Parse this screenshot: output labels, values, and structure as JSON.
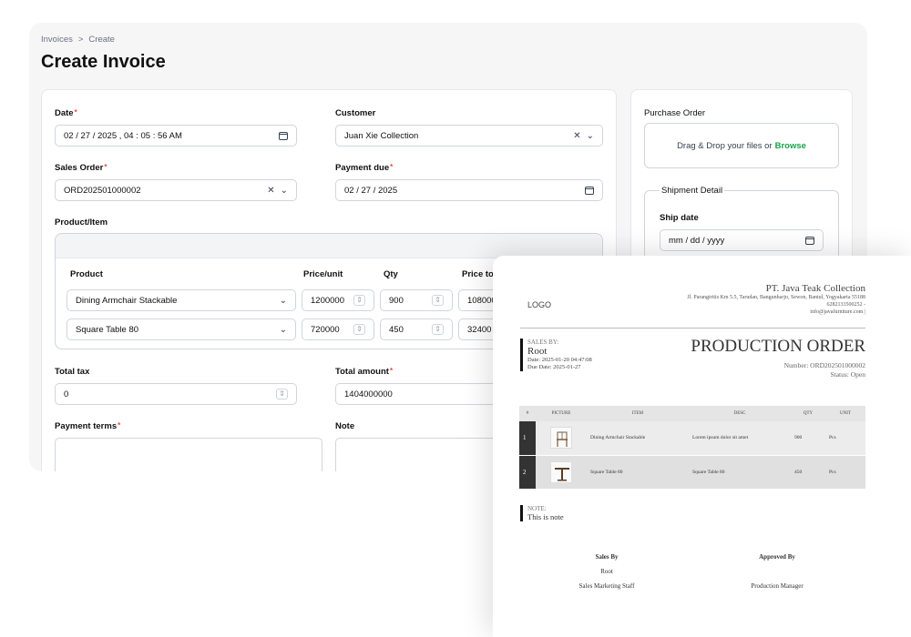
{
  "breadcrumb": {
    "items": [
      "Invoices",
      "Create"
    ],
    "separator": ">"
  },
  "page_title": "Create Invoice",
  "form": {
    "date": {
      "label": "Date",
      "value": "02 / 27 / 2025 ,  04 : 05 : 56   AM"
    },
    "customer": {
      "label": "Customer",
      "value": "Juan Xie Collection"
    },
    "sales_order": {
      "label": "Sales Order",
      "value": "ORD202501000002"
    },
    "payment_due": {
      "label": "Payment due",
      "value": "02 / 27 / 2025"
    },
    "product_item_label": "Product/Item",
    "table": {
      "headers": [
        "Product",
        "Price/unit",
        "Qty",
        "Price tot"
      ],
      "rows": [
        {
          "product": "Dining Armchair Stackable",
          "price": "1200000",
          "qty": "900",
          "total": "108000"
        },
        {
          "product": "Square Table 80",
          "price": "720000",
          "qty": "450",
          "total": "32400"
        }
      ]
    },
    "total_tax": {
      "label": "Total tax",
      "value": "0"
    },
    "total_amount": {
      "label": "Total amount",
      "value": "1404000000"
    },
    "payment_terms": {
      "label": "Payment terms"
    },
    "note": {
      "label": "Note"
    }
  },
  "side": {
    "purchase_order_label": "Purchase Order",
    "dropzone_text": "Drag & Drop your files or",
    "browse_label": "Browse",
    "shipment_detail_label": "Shipment Detail",
    "ship_date_label": "Ship date",
    "ship_date_placeholder": "mm / dd / yyyy"
  },
  "doc": {
    "logo": "LOGO",
    "company_name": "PT. Java Teak Collection",
    "address": "Jl. Parangtritis Km 5.5, Tarudan, Bangunharjo, Sewon, Bantul, Yogyakarta 55188",
    "phone": "6282133500252 -",
    "email": "info@javafurniture.com |",
    "sales_by_caption": "SALES BY:",
    "sales_by_name": "Root",
    "date_line": "Date: 2025-01-20 04:47:08",
    "due_line": "Due Date: 2025-01-27",
    "title": "PRODUCTION ORDER",
    "number_line": "Number: ORD202501000002",
    "status_line": "Status: Open",
    "table_headers": [
      "#",
      "PICTURE",
      "ITEM",
      "DESC",
      "QTY",
      "UNIT"
    ],
    "rows": [
      {
        "no": "1",
        "item": "Dining Armchair Stackable",
        "desc": "Lorem ipsum dolor sit amet",
        "qty": "900",
        "unit": "Pcs"
      },
      {
        "no": "2",
        "item": "Square Table 80",
        "desc": "Square Table 80",
        "qty": "450",
        "unit": "Pcs"
      }
    ],
    "note_caption": "NOTE:",
    "note_text": "This is note",
    "sales_by_heading": "Sales By",
    "sales_by_person": "Root",
    "sales_by_role": "Sales Marketing Staff",
    "approved_by_heading": "Approved By",
    "approved_by_role": "Production Manager"
  }
}
